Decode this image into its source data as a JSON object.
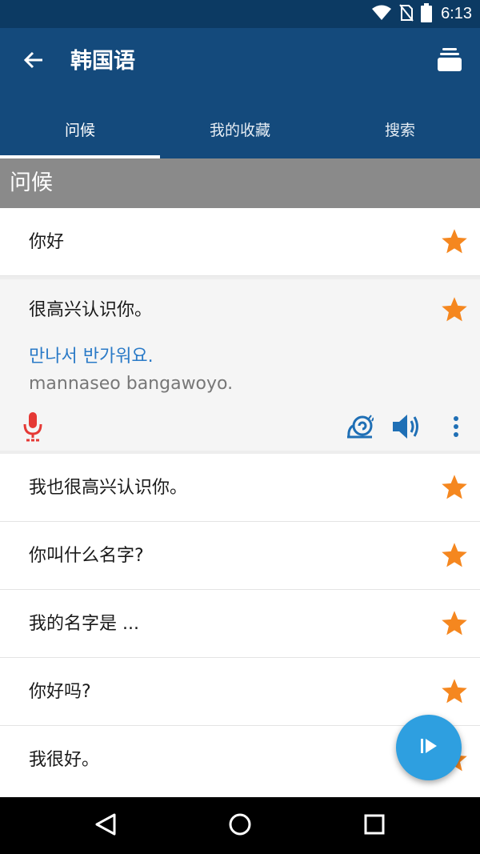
{
  "status_bar": {
    "time": "6:13",
    "icons": [
      "wifi-icon",
      "no-sim-icon",
      "battery-icon"
    ]
  },
  "app_bar": {
    "title": "韩国语",
    "back_icon": "arrow-left-icon",
    "action_icon": "flashcards-icon"
  },
  "tabs": [
    {
      "label": "问候",
      "active": true
    },
    {
      "label": "我的收藏",
      "active": false
    },
    {
      "label": "搜索",
      "active": false
    }
  ],
  "section": {
    "title": "问候"
  },
  "phrases": {
    "row1": {
      "zh": "你好",
      "starred": true
    },
    "expanded": {
      "zh": "很高兴认识你。",
      "ko": "만나서 반가워요.",
      "romanization": "mannaseo bangawoyo.",
      "starred": true,
      "controls": [
        "microphone-icon",
        "snail-slow-icon",
        "speaker-icon",
        "more-vert-icon"
      ]
    },
    "row3": {
      "zh": "我也很高兴认识你。",
      "starred": true
    },
    "row4": {
      "zh": "你叫什么名字?",
      "starred": true
    },
    "row5": {
      "zh": "我的名字是 ...",
      "starred": true
    },
    "row6": {
      "zh": "你好吗?",
      "starred": true
    },
    "row7": {
      "zh": "我很好。",
      "starred": true
    }
  },
  "colors": {
    "status_bar": "#0c3a63",
    "app_bar": "#144a7c",
    "section_header": "#8a8a8a",
    "star": "#f5871f",
    "korean_text": "#2a7ac7",
    "mic": "#e53935",
    "controls": "#1f6fb5",
    "fab": "#2e9fe0"
  }
}
